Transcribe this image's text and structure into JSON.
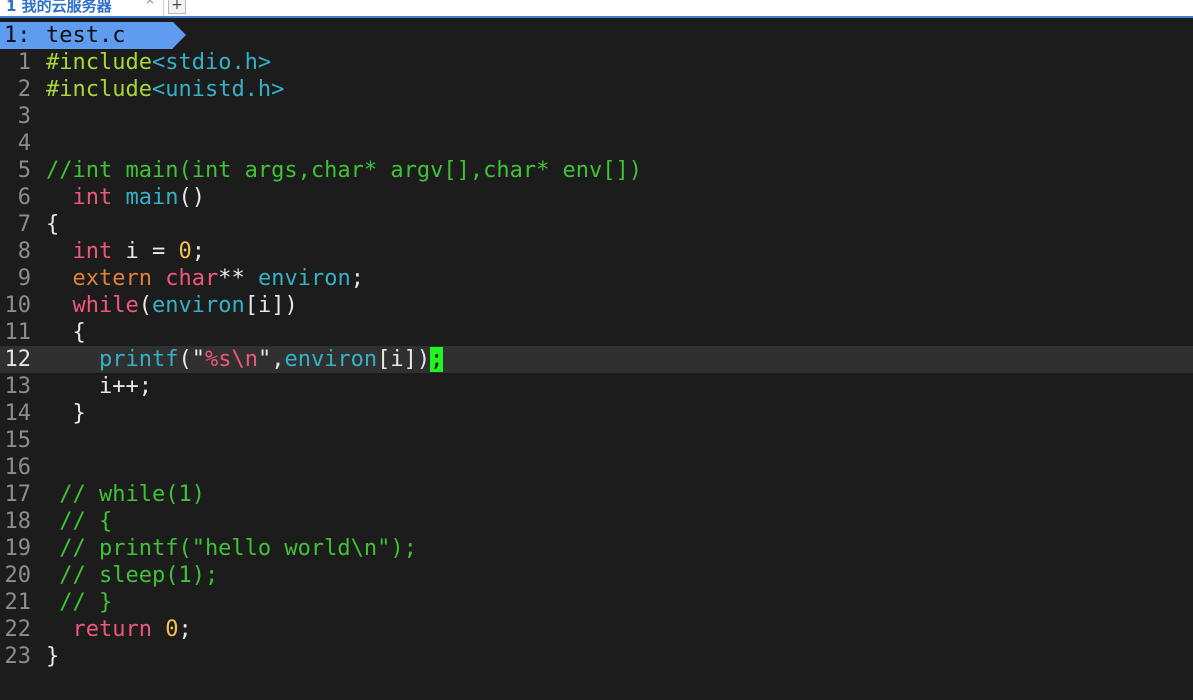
{
  "terminal": {
    "tab_title": "1 我的云服务器",
    "close_glyph": "×",
    "add_glyph": "+"
  },
  "vim": {
    "buffer_number": "1:",
    "buffer_name": "test.c",
    "cursor_line": 12
  },
  "colors": {
    "background": "#1c1c1c",
    "cursorline": "#303030",
    "comment": "#3fc236",
    "keyword": "#f0577d",
    "identifier": "#35b1c7",
    "number": "#f3c24a",
    "buffer_tab": "#5f9cf0",
    "cursor": "#20f520"
  },
  "lines": [
    {
      "n": "1",
      "tokens": [
        {
          "t": "#include",
          "c": "green"
        },
        {
          "t": "<stdio.h>",
          "c": "ident"
        }
      ]
    },
    {
      "n": "2",
      "tokens": [
        {
          "t": "#include",
          "c": "green"
        },
        {
          "t": "<unistd.h>",
          "c": "ident"
        }
      ]
    },
    {
      "n": "3",
      "tokens": []
    },
    {
      "n": "4",
      "tokens": []
    },
    {
      "n": "5",
      "tokens": [
        {
          "t": "//int main(int args,char* argv[],char* env[])",
          "c": "comment"
        }
      ]
    },
    {
      "n": "6",
      "tokens": [
        {
          "t": "  ",
          "c": "default"
        },
        {
          "t": "int",
          "c": "type"
        },
        {
          "t": " ",
          "c": "default"
        },
        {
          "t": "main",
          "c": "ident"
        },
        {
          "t": "()",
          "c": "default"
        }
      ]
    },
    {
      "n": "7",
      "tokens": [
        {
          "t": "{",
          "c": "default"
        }
      ]
    },
    {
      "n": "8",
      "tokens": [
        {
          "t": "  ",
          "c": "default"
        },
        {
          "t": "int",
          "c": "type"
        },
        {
          "t": " i = ",
          "c": "default"
        },
        {
          "t": "0",
          "c": "number"
        },
        {
          "t": ";",
          "c": "default"
        }
      ]
    },
    {
      "n": "9",
      "tokens": [
        {
          "t": "  ",
          "c": "default"
        },
        {
          "t": "extern",
          "c": "orange"
        },
        {
          "t": " ",
          "c": "default"
        },
        {
          "t": "char",
          "c": "type"
        },
        {
          "t": "** ",
          "c": "default"
        },
        {
          "t": "environ",
          "c": "ident"
        },
        {
          "t": ";",
          "c": "default"
        }
      ]
    },
    {
      "n": "10",
      "tokens": [
        {
          "t": "  ",
          "c": "default"
        },
        {
          "t": "while",
          "c": "keyword"
        },
        {
          "t": "(",
          "c": "default"
        },
        {
          "t": "environ",
          "c": "ident"
        },
        {
          "t": "[i])",
          "c": "default"
        }
      ]
    },
    {
      "n": "11",
      "tokens": [
        {
          "t": "  {",
          "c": "default"
        }
      ]
    },
    {
      "n": "12",
      "tokens": [
        {
          "t": "    ",
          "c": "default"
        },
        {
          "t": "printf",
          "c": "ident"
        },
        {
          "t": "(\"",
          "c": "default"
        },
        {
          "t": "%s\\n",
          "c": "format"
        },
        {
          "t": "\",",
          "c": "default"
        },
        {
          "t": "environ",
          "c": "ident"
        },
        {
          "t": "[i])",
          "c": "default"
        },
        {
          "t": ";",
          "c": "cursor"
        }
      ]
    },
    {
      "n": "13",
      "tokens": [
        {
          "t": "    i++;",
          "c": "default"
        }
      ]
    },
    {
      "n": "14",
      "tokens": [
        {
          "t": "  }",
          "c": "default"
        }
      ]
    },
    {
      "n": "15",
      "tokens": []
    },
    {
      "n": "16",
      "tokens": []
    },
    {
      "n": "17",
      "tokens": [
        {
          "t": " // while(1)",
          "c": "comment"
        }
      ]
    },
    {
      "n": "18",
      "tokens": [
        {
          "t": " // {",
          "c": "comment"
        }
      ]
    },
    {
      "n": "19",
      "tokens": [
        {
          "t": " // printf(\"hello world\\n\");",
          "c": "comment"
        }
      ]
    },
    {
      "n": "20",
      "tokens": [
        {
          "t": " // sleep(1);",
          "c": "comment"
        }
      ]
    },
    {
      "n": "21",
      "tokens": [
        {
          "t": " // }",
          "c": "comment"
        }
      ]
    },
    {
      "n": "22",
      "tokens": [
        {
          "t": "  ",
          "c": "default"
        },
        {
          "t": "return",
          "c": "keyword"
        },
        {
          "t": " ",
          "c": "default"
        },
        {
          "t": "0",
          "c": "number"
        },
        {
          "t": ";",
          "c": "default"
        }
      ]
    },
    {
      "n": "23",
      "tokens": [
        {
          "t": "}",
          "c": "default"
        }
      ]
    }
  ]
}
